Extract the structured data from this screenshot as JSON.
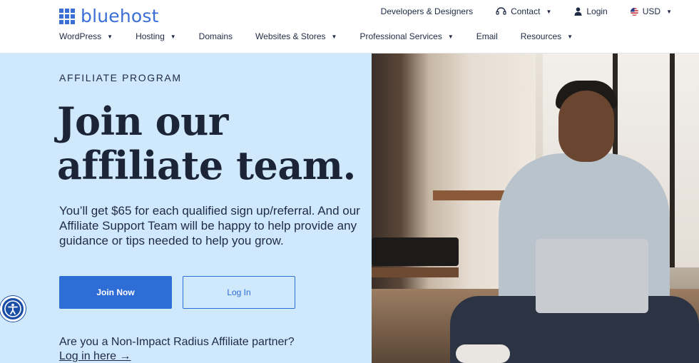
{
  "brand": {
    "logo_text": "bluehost",
    "accent_color": "#3b6fd6"
  },
  "topnav": {
    "developers": "Developers & Designers",
    "contact": "Contact",
    "login": "Login",
    "currency": "USD"
  },
  "mainnav": {
    "items": [
      {
        "label": "WordPress",
        "has_dropdown": true
      },
      {
        "label": "Hosting",
        "has_dropdown": true
      },
      {
        "label": "Domains",
        "has_dropdown": false
      },
      {
        "label": "Websites & Stores",
        "has_dropdown": true
      },
      {
        "label": "Professional Services",
        "has_dropdown": true
      },
      {
        "label": "Email",
        "has_dropdown": false
      },
      {
        "label": "Resources",
        "has_dropdown": true
      }
    ]
  },
  "hero": {
    "eyebrow": "AFFILIATE PROGRAM",
    "headline": "Join our affiliate team.",
    "description": "You’ll get $65 for each qualified sign up/referral. And our Affiliate Support Team will be happy to help provide any guidance or tips needed to help you grow.",
    "join_button": "Join Now",
    "login_button": "Log In",
    "partner_question": "Are you a Non-Impact Radius Affiliate partner?",
    "partner_link": "Log in here →",
    "background_color": "#cfe8fc"
  },
  "icons": {
    "logo": "grid-logo-icon",
    "contact": "headset-icon",
    "login": "user-icon",
    "currency": "us-flag-icon",
    "accessibility": "accessibility-icon",
    "dropdown": "chevron-down-icon"
  }
}
